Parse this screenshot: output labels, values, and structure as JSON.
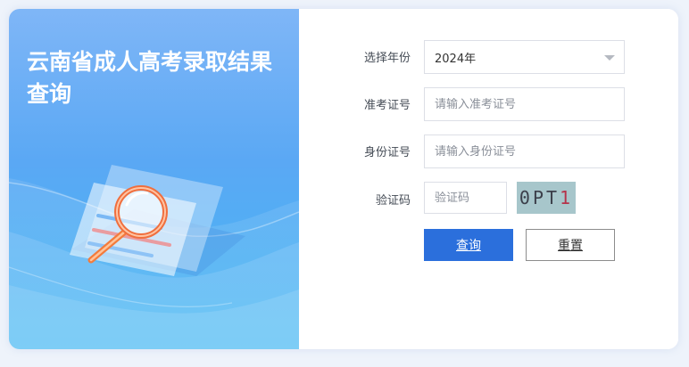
{
  "left_panel": {
    "title_line1": "云南省成人高考录取结果",
    "title_line2": "查询"
  },
  "form": {
    "year": {
      "label": "选择年份",
      "selected": "2024年"
    },
    "exam_number": {
      "label": "准考证号",
      "placeholder": "请输入准考证号"
    },
    "id_number": {
      "label": "身份证号",
      "placeholder": "请输入身份证号"
    },
    "captcha": {
      "label": "验证码",
      "placeholder": "验证码",
      "image_text": "0PT",
      "image_text_last": "1"
    }
  },
  "buttons": {
    "query_label": "查询",
    "reset_label": "重置"
  },
  "colors": {
    "primary": "#2b6fdc",
    "panel_gradient_top": "#7fb6f7",
    "panel_gradient_bottom": "#45b8f3"
  },
  "icons": {
    "illustration": "magnifier-over-documents-illustration",
    "dropdown": "chevron-down-icon"
  }
}
